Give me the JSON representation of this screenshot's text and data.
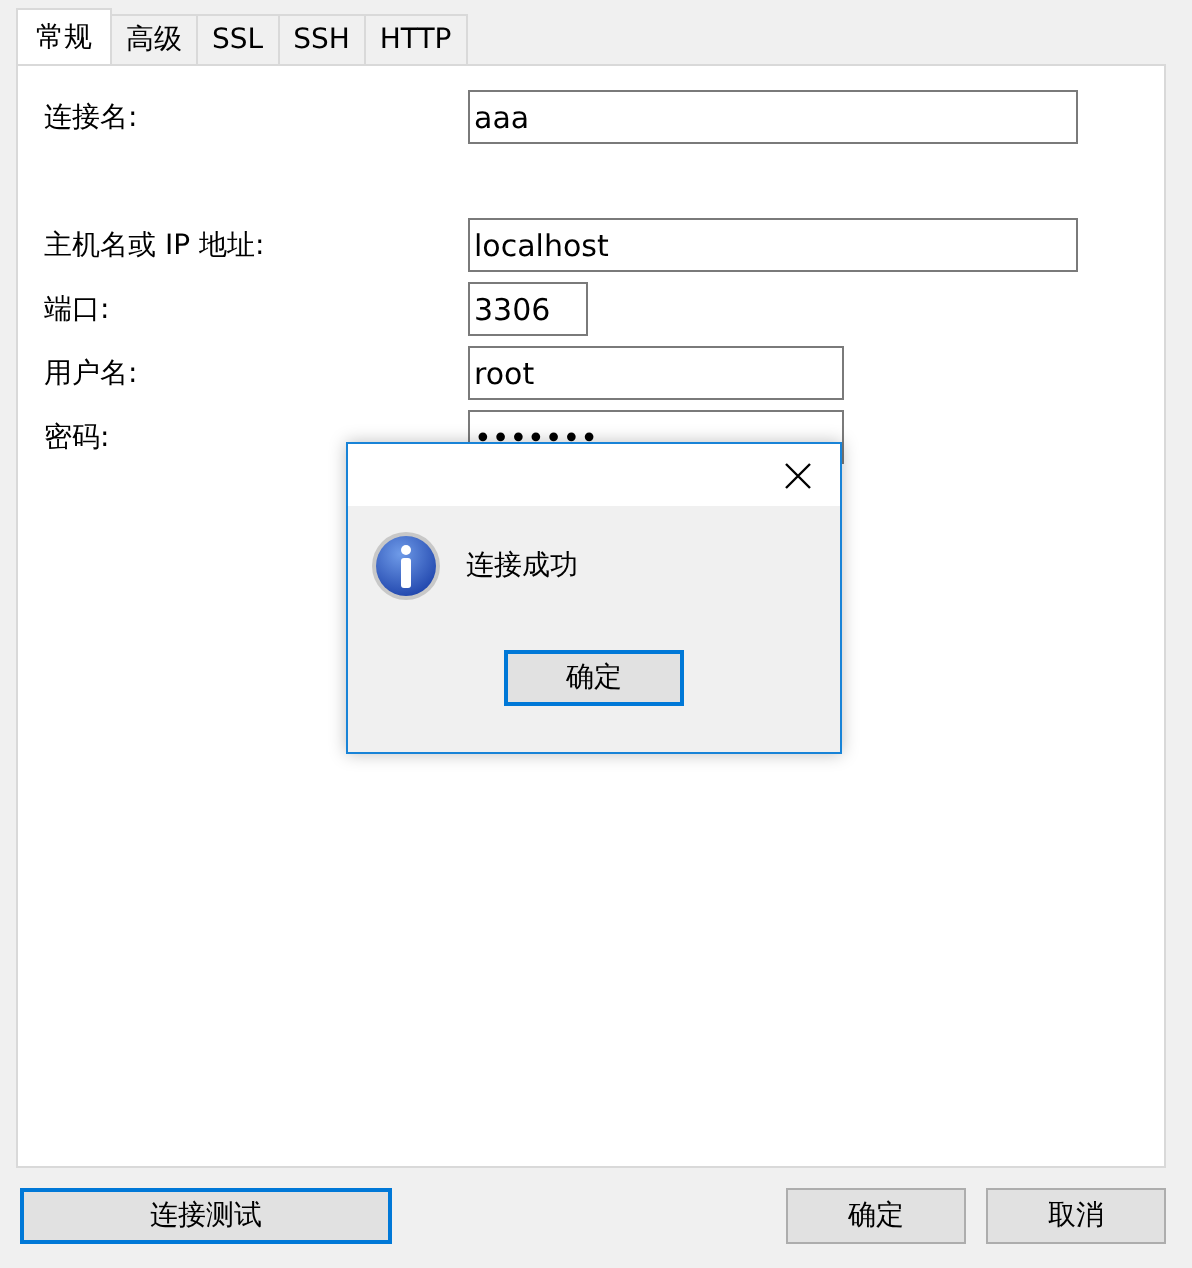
{
  "tabs": [
    {
      "label": "常规",
      "selected": true
    },
    {
      "label": "高级",
      "selected": false
    },
    {
      "label": "SSL",
      "selected": false
    },
    {
      "label": "SSH",
      "selected": false
    },
    {
      "label": "HTTP",
      "selected": false
    }
  ],
  "form": [
    {
      "label": "连接名:",
      "value": "aaa"
    },
    {
      "label": "主机名或 IP 地址:",
      "value": "localhost"
    },
    {
      "label": "端口:",
      "value": "3306"
    },
    {
      "label": "用户名:",
      "value": "root"
    },
    {
      "label": "密码:",
      "value": "•••••••"
    }
  ],
  "dialog": {
    "message": "连接成功",
    "button": "确定"
  },
  "buttons": {
    "test": "连接测试",
    "ok": "确定",
    "cancel": "取消"
  }
}
